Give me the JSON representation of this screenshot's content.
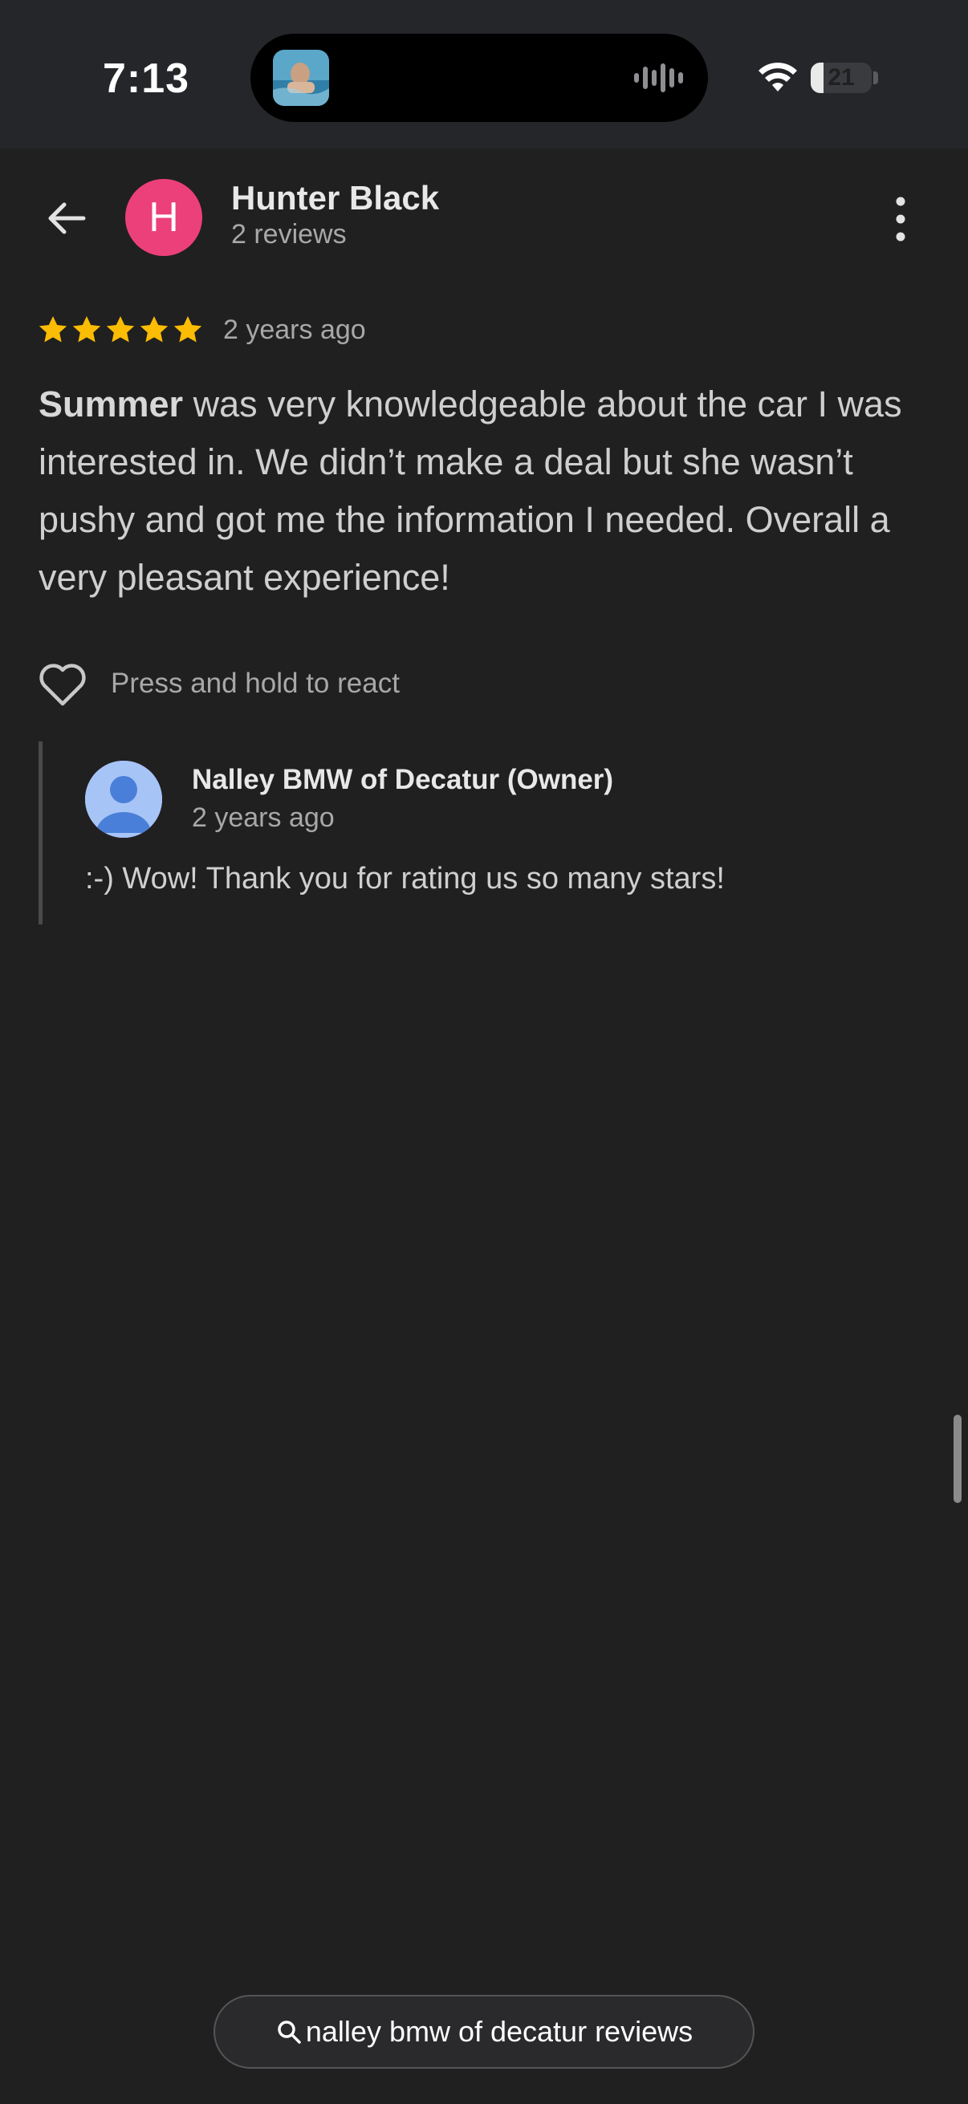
{
  "status_bar": {
    "time": "7:13",
    "battery_level": "21",
    "battery_fraction": 0.21
  },
  "header": {
    "reviewer_name": "Hunter Black",
    "reviewer_reviews": "2 reviews",
    "avatar_letter": "H",
    "avatar_color": "#ec407a"
  },
  "review": {
    "rating": 5,
    "max_rating": 5,
    "date": "2 years ago",
    "highlight": "Summer",
    "text": " was very knowledgeable about the car I was interested in. We didn’t make a deal but she wasn’t pushy and got me the information I needed. Overall a very pleasant experience!",
    "star_color": "#fbbc04"
  },
  "reactions": {
    "hint": "Press and hold to react"
  },
  "owner_reply": {
    "name": "Nalley BMW of Decatur (Owner)",
    "date": "2 years ago",
    "text": ":-) Wow! Thank you for rating us so many stars!"
  },
  "bottom_search": {
    "query": "nalley bmw of decatur reviews"
  },
  "icons": {
    "back": "arrow-left-icon",
    "more": "more-vert-icon",
    "heart": "heart-outline-icon",
    "search": "search-icon",
    "wifi": "wifi-icon"
  }
}
